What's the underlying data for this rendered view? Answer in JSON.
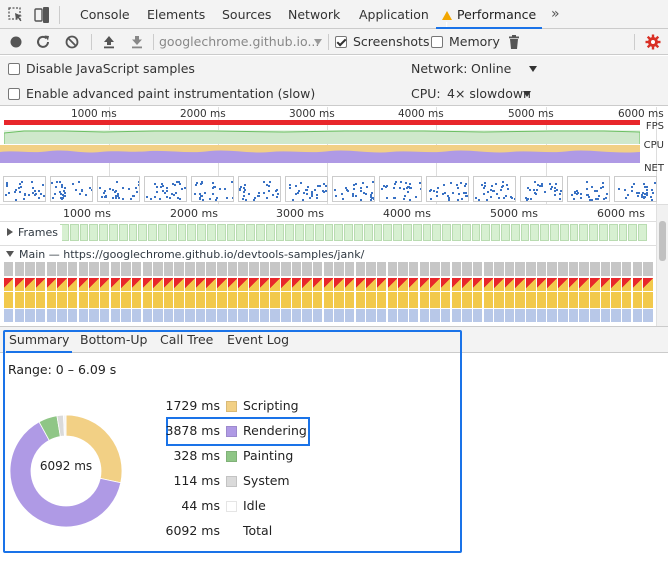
{
  "devtools": {
    "tabs": [
      "Console",
      "Elements",
      "Sources",
      "Network",
      "Application",
      "Performance"
    ],
    "more_tabs_glyph": "»"
  },
  "toolbar": {
    "url": "googlechrome.github.io...",
    "screenshots_label": "Screenshots",
    "screenshots_checked": true,
    "memory_label": "Memory",
    "memory_checked": false,
    "icons": [
      "record-icon",
      "reload-icon",
      "clear-icon",
      "upload-icon",
      "download-icon",
      "trash-icon",
      "gear-icon"
    ]
  },
  "settings": {
    "disable_js_samples": "Disable JavaScript samples",
    "advanced_paint": "Enable advanced paint instrumentation (slow)",
    "network_label": "Network:",
    "network_value": "Online",
    "cpu_label": "CPU:",
    "cpu_value": "4× slowdown"
  },
  "overview": {
    "ticks": [
      "1000 ms",
      "2000 ms",
      "3000 ms",
      "4000 ms",
      "5000 ms",
      "6000 ms"
    ],
    "tracks": [
      "FPS",
      "CPU",
      "NET"
    ]
  },
  "flame": {
    "ticks": [
      "1000 ms",
      "2000 ms",
      "3000 ms",
      "4000 ms",
      "5000 ms",
      "6000 ms"
    ],
    "frames_label": "Frames",
    "main_label": "Main — https://googlechrome.github.io/devtools-samples/jank/"
  },
  "summary": {
    "tabs": [
      "Summary",
      "Bottom-Up",
      "Call Tree",
      "Event Log"
    ],
    "range": "Range: 0 – 6.09 s",
    "center_label": "6092 ms",
    "rows": [
      {
        "ms": "1729 ms",
        "label": "Scripting",
        "color": "#f2d085"
      },
      {
        "ms": "3878 ms",
        "label": "Rendering",
        "color": "#af9ae5"
      },
      {
        "ms": "328 ms",
        "label": "Painting",
        "color": "#8fc686"
      },
      {
        "ms": "114 ms",
        "label": "System",
        "color": "#dadada"
      },
      {
        "ms": "44 ms",
        "label": "Idle",
        "color": "#ffffff"
      },
      {
        "ms": "6092 ms",
        "label": "Total",
        "color": ""
      }
    ],
    "highlighted_row": "Rendering"
  },
  "chart_data": {
    "type": "pie",
    "categories": [
      "Scripting",
      "Rendering",
      "Painting",
      "System",
      "Idle"
    ],
    "values": [
      1729,
      3878,
      328,
      114,
      44
    ],
    "colors": [
      "#f2d085",
      "#af9ae5",
      "#8fc686",
      "#dadada",
      "#f5f5f5"
    ],
    "total": 6092
  }
}
